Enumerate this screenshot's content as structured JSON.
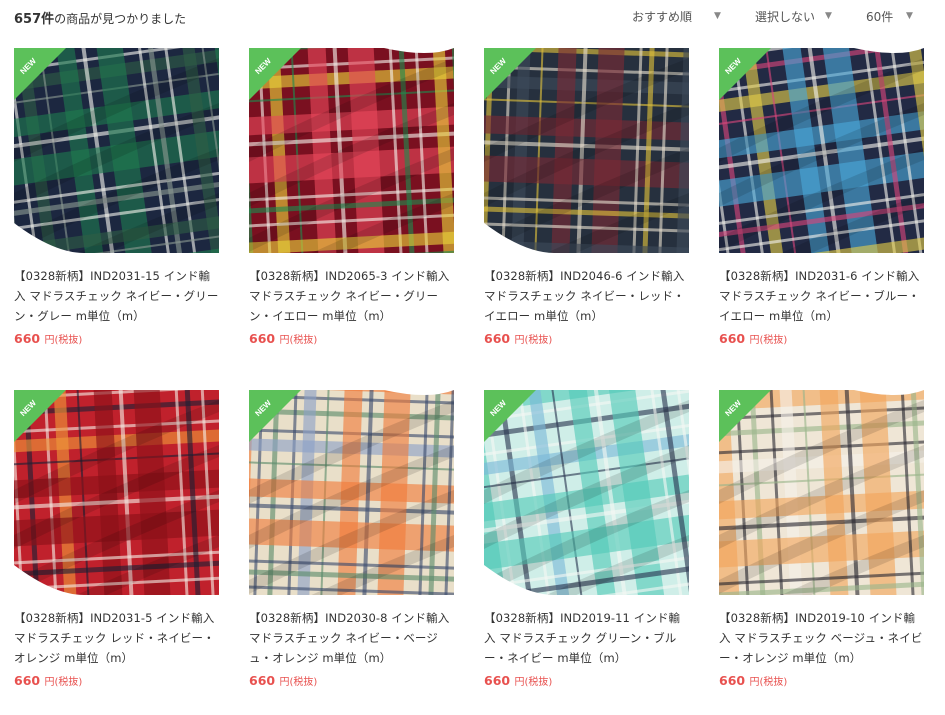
{
  "result": {
    "count": "657件",
    "suffix": "の商品が見つかりました"
  },
  "controls": {
    "sort": "おすすめ順",
    "filter": "選択しない",
    "per_page": "60件",
    "arrow": "▼"
  },
  "badge_label": "NEW",
  "products": [
    {
      "title": "【0328新柄】IND2031-15 インド輸入 マドラスチェック ネイビー・グリーン・グレー m単位（m）",
      "price": "660",
      "unit": "円(税抜)",
      "palette": {
        "bg": "#1c2740",
        "c1": "#1f7a4f",
        "c2": "#f2f2ec",
        "c3": "#8a9a92",
        "c4": "#2e5e45"
      }
    },
    {
      "title": "【0328新柄】IND2065-3 インド輸入 マドラスチェック ネイビー・グリーン・イエロー m単位（m）",
      "price": "660",
      "unit": "円(税抜)",
      "palette": {
        "bg": "#7a1020",
        "c1": "#e9475a",
        "c2": "#f5f0ea",
        "c3": "#1e8a4e",
        "c4": "#e8d23a"
      }
    },
    {
      "title": "【0328新柄】IND2046-6 インド輸入 マドラスチェック ネイビー・レッド・イエロー m単位（m）",
      "price": "660",
      "unit": "円(税抜)",
      "palette": {
        "bg": "#26303e",
        "c1": "#7a2a35",
        "c2": "#e7dfcf",
        "c3": "#e0c23c",
        "c4": "#3e4a5a"
      }
    },
    {
      "title": "【0328新柄】IND2031-6 インド輸入 マドラスチェック ネイビー・ブルー・イエロー m単位（m）",
      "price": "660",
      "unit": "円(税抜)",
      "palette": {
        "bg": "#222a44",
        "c1": "#4aa8d8",
        "c2": "#f2f0ea",
        "c3": "#d9467a",
        "c4": "#e3cd49"
      }
    },
    {
      "title": "【0328新柄】IND2031-5 インド輸入 マドラスチェック レッド・ネイビー・オレンジ m単位（m）",
      "price": "660",
      "unit": "円(税抜)",
      "palette": {
        "bg": "#c0212c",
        "c1": "#8a1018",
        "c2": "#f3ece4",
        "c3": "#1c2036",
        "c4": "#ef9a3a"
      }
    },
    {
      "title": "【0328新柄】IND2030-8 インド輸入 マドラスチェック ネイビー・ベージュ・オレンジ m単位（m）",
      "price": "660",
      "unit": "円(税抜)",
      "palette": {
        "bg": "#e9dfc9",
        "c1": "#f07a3a",
        "c2": "#3a4a6e",
        "c3": "#5a8a6a",
        "c4": "#8aa0c8"
      }
    },
    {
      "title": "【0328新柄】IND2019-11 インド輸入 マドラスチェック グリーン・ブルー・ネイビー m単位（m）",
      "price": "660",
      "unit": "円(税抜)",
      "palette": {
        "bg": "#cfeee8",
        "c1": "#53c9b8",
        "c2": "#f4f7f4",
        "c3": "#2a3550",
        "c4": "#7ab8d8"
      }
    },
    {
      "title": "【0328新柄】IND2019-10 インド輸入 マドラスチェック ベージュ・ネイビー・オレンジ m単位（m）",
      "price": "660",
      "unit": "円(税抜)",
      "palette": {
        "bg": "#efe6d6",
        "c1": "#f2a45a",
        "c2": "#2b2a34",
        "c3": "#9ab48a",
        "c4": "#f6f1ea"
      }
    }
  ]
}
